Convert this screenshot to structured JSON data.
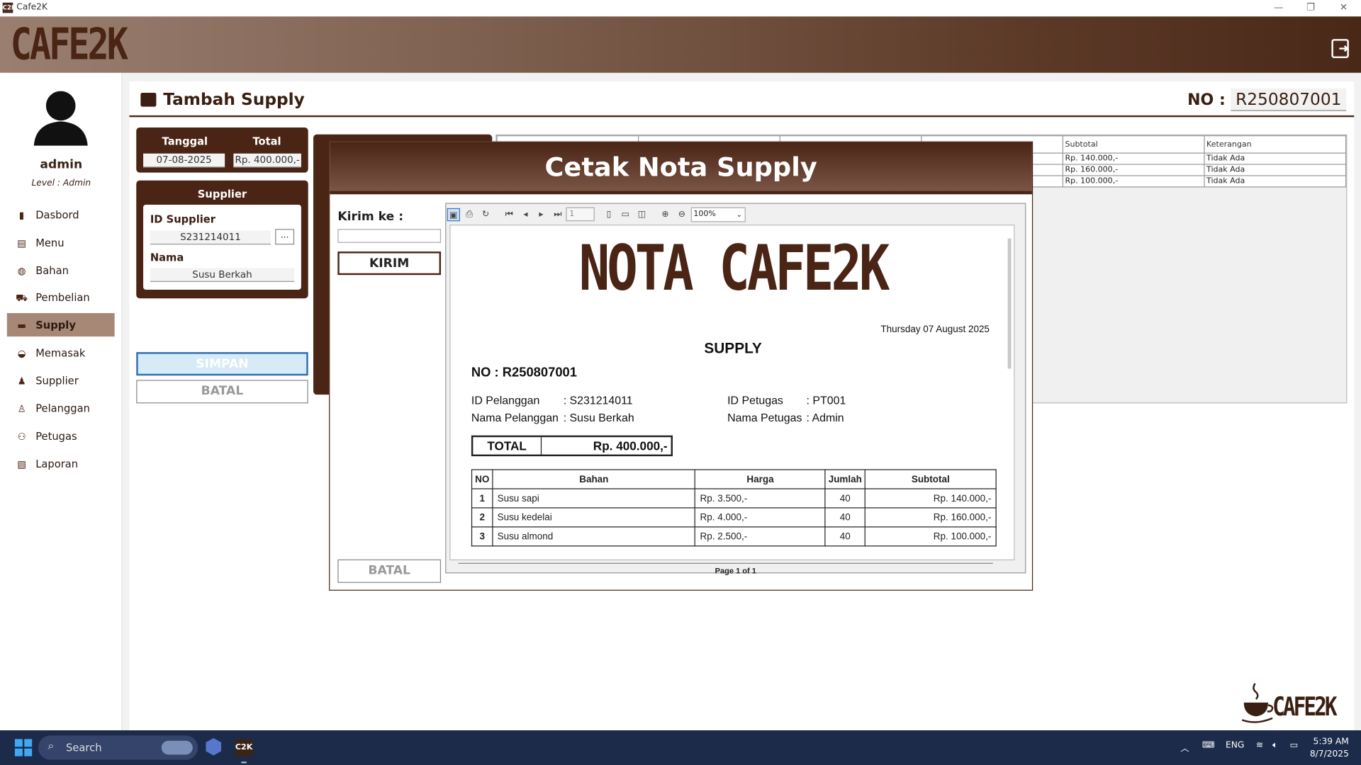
{
  "window": {
    "title": "Cafe2K",
    "app_icon": "C2K"
  },
  "header": {
    "logo": "CAFE2K"
  },
  "user": {
    "name": "admin",
    "level": "Level : Admin"
  },
  "nav": [
    {
      "label": "Dasbord",
      "icon": "dashboard-icon",
      "active": false
    },
    {
      "label": "Menu",
      "icon": "book-icon",
      "active": false
    },
    {
      "label": "Bahan",
      "icon": "ingredients-icon",
      "active": false
    },
    {
      "label": "Pembelian",
      "icon": "cart-icon",
      "active": false
    },
    {
      "label": "Supply",
      "icon": "box-icon",
      "active": true
    },
    {
      "label": "Memasak",
      "icon": "pot-icon",
      "active": false
    },
    {
      "label": "Supplier",
      "icon": "user-tie-icon",
      "active": false
    },
    {
      "label": "Pelanggan",
      "icon": "customer-icon",
      "active": false
    },
    {
      "label": "Petugas",
      "icon": "staff-icon",
      "active": false
    },
    {
      "label": "Laporan",
      "icon": "report-icon",
      "active": false
    }
  ],
  "page": {
    "title": "Tambah Supply",
    "no_label": "NO :",
    "no_value": "R250807001"
  },
  "summary": {
    "tanggal_label": "Tanggal",
    "total_label": "Total",
    "tanggal": "07-08-2025",
    "total": "Rp. 400.000,-"
  },
  "supplier": {
    "header": "Supplier",
    "id_label": "ID Supplier",
    "id": "S231214011",
    "browse": "...",
    "nama_label": "Nama",
    "nama": "Susu Berkah"
  },
  "buttons": {
    "simpan": "SIMPAN",
    "batal": "BATAL"
  },
  "bg_table": {
    "headers": [
      "",
      "",
      "",
      "",
      "Subtotal",
      "Keterangan"
    ],
    "rows": [
      [
        "",
        "",
        "",
        "",
        "Rp. 140.000,-",
        "Tidak Ada"
      ],
      [
        "",
        "",
        "",
        "",
        "Rp. 160.000,-",
        "Tidak Ada"
      ],
      [
        "",
        "",
        "",
        "",
        "Rp. 100.000,-",
        "Tidak Ada"
      ]
    ]
  },
  "modal": {
    "title": "Cetak Nota Supply",
    "kirim_label": "Kirim ke :",
    "kirim_value": "",
    "kirim_button": "KIRIM",
    "batal_button": "BATAL",
    "toolbar": {
      "page": "1",
      "zoom": "100%"
    },
    "page_footer": "Page 1 of 1"
  },
  "report": {
    "title": "NOTA CAFE2K",
    "date": "Thursday 07 August 2025",
    "type": "SUPPLY",
    "no": "NO : R250807001",
    "id_pelanggan_label": "ID Pelanggan",
    "id_pelanggan": ": S231214011",
    "nama_pelanggan_label": "Nama Pelanggan",
    "nama_pelanggan": ": Susu Berkah",
    "id_petugas_label": "ID Petugas",
    "id_petugas": ": PT001",
    "nama_petugas_label": "Nama Petugas",
    "nama_petugas": ": Admin",
    "total_label": "TOTAL",
    "total": "Rp. 400.000,-",
    "columns": [
      "NO",
      "Bahan",
      "Harga",
      "Jumlah",
      "Subtotal"
    ],
    "rows": [
      [
        "1",
        "Susu sapi",
        "Rp. 3.500,-",
        "40",
        "Rp. 140.000,-"
      ],
      [
        "2",
        "Susu kedelai",
        "Rp. 4.000,-",
        "40",
        "Rp. 160.000,-"
      ],
      [
        "3",
        "Susu almond",
        "Rp. 2.500,-",
        "40",
        "Rp. 100.000,-"
      ]
    ]
  },
  "watermark": {
    "text": "CAFE2K"
  },
  "taskbar": {
    "search": "Search",
    "lang": "ENG",
    "time": "5:39 AM",
    "date": "8/7/2025"
  },
  "colors": {
    "brand": "#4a2414",
    "active_nav": "#a78776",
    "taskbar": "#1c2b4a"
  }
}
